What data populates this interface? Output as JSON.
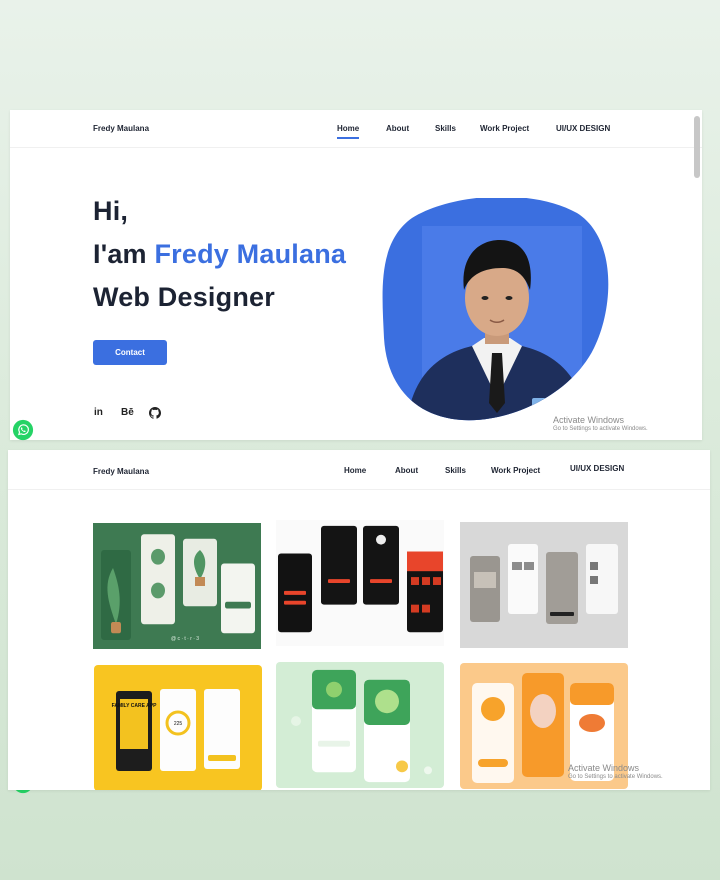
{
  "brand": "Fredy Maulana",
  "nav": {
    "items": [
      {
        "label": "Home",
        "active": true
      },
      {
        "label": "About"
      },
      {
        "label": "Skills"
      },
      {
        "label": "Work Project"
      },
      {
        "label": "UI/UX DESIGN"
      }
    ]
  },
  "hero": {
    "line1": "Hi,",
    "line2_prefix": "I'am ",
    "line2_name": "Fredy Maulana",
    "line3": "Web Designer",
    "contact_label": "Contact"
  },
  "social": [
    "in",
    "Bē"
  ],
  "watermark": {
    "title": "Activate Windows",
    "subtitle": "Go to Settings to activate Windows."
  },
  "colors": {
    "accent": "#3b6fe0",
    "blob": "#3b6fe0",
    "whatsapp": "#25d366",
    "text": "#1c2333"
  },
  "projects_labels": {
    "family_app_title": "FAMILY CARE APP",
    "family_app_value": "225"
  }
}
